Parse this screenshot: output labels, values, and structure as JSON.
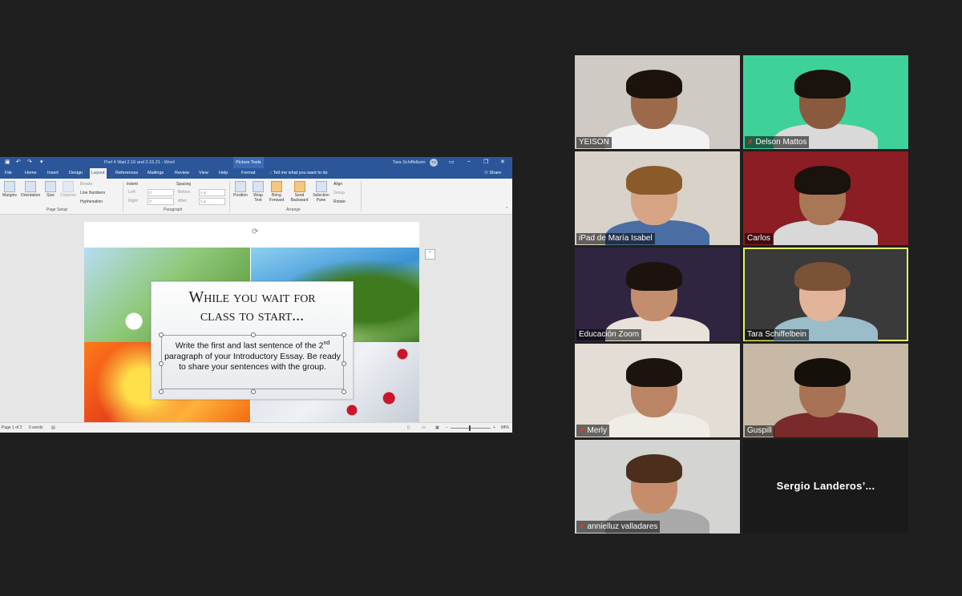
{
  "word": {
    "title": "Pref 4 Wait 2.16 and 2.15.21  -  Word",
    "picture_tools": "Picture Tools",
    "user": "Tara Schiffelbein",
    "user_initials": "TS",
    "tabs": [
      "File",
      "Home",
      "Insert",
      "Design",
      "Layout",
      "References",
      "Mailings",
      "Review",
      "View",
      "Help",
      "Format"
    ],
    "active_tab": "Layout",
    "tell_me": "Tell me what you want to do",
    "share": "Share",
    "ribbon": {
      "margins": "Margins",
      "orientation": "Orientation",
      "size": "Size",
      "columns": "Columns",
      "breaks": "Breaks",
      "line_numbers": "Line Numbers",
      "hyphenation": "Hyphenation",
      "indent": "Indent",
      "indent_left": "Left:",
      "indent_right": "Right:",
      "spacing": "Spacing",
      "spacing_before": "Before:",
      "spacing_after": "After:",
      "indent_left_value": "0\"",
      "indent_right_value": "0\"",
      "spacing_before_value": "0 pt",
      "spacing_after_value": "0 pt",
      "position": "Position",
      "wrap_text": "Wrap Text",
      "bring_forward": "Bring Forward",
      "send_backward": "Send Backward",
      "selection_pane": "Selection Pane",
      "align": "Align",
      "group": "Group",
      "rotate": "Rotate",
      "group_page_setup": "Page Setup",
      "group_paragraph": "Paragraph",
      "group_arrange": "Arrange"
    },
    "card_title_line1": "While you wait for",
    "card_title_line2": "class to start...",
    "card_body_a": "Write the first and last sentence of the 2",
    "card_body_sup": "nd",
    "card_body_b": "paragraph of your Introductory Essay. Be ready to share your sentences with the group.",
    "status_page": "Page 1 of 2",
    "status_words": "0 words",
    "zoom": "84%"
  },
  "participants": [
    {
      "name": "YEISON",
      "muted": false,
      "speaking": false,
      "bg": "#cfcac3",
      "shirt": "#f2f2f2",
      "hair": "#1b120c",
      "skin": "#9c6a4b"
    },
    {
      "name": "Delson Mattos",
      "muted": true,
      "speaking": false,
      "bg": "#3ed29a",
      "shirt": "#d9d9d9",
      "hair": "#1a120c",
      "skin": "#8a5a3e"
    },
    {
      "name": "iPad de María Isabel",
      "muted": false,
      "speaking": false,
      "bg": "#d8d2c9",
      "shirt": "#4a6ea3",
      "hair": "#8b5a2b",
      "skin": "#d6a385"
    },
    {
      "name": "Carlos",
      "muted": false,
      "speaking": false,
      "bg": "#8c1d24",
      "shirt": "#d8d8d8",
      "hair": "#1a120c",
      "skin": "#a97755"
    },
    {
      "name": "Educación Zoom",
      "muted": false,
      "speaking": false,
      "bg": "#2f2540",
      "shirt": "#e8e2da",
      "hair": "#1d130e",
      "skin": "#c38e6d"
    },
    {
      "name": "Tara Schiffelbein",
      "muted": false,
      "speaking": true,
      "bg": "#3a3a3a",
      "shirt": "#9bbcc9",
      "hair": "#7a5235",
      "skin": "#e2b49a"
    },
    {
      "name": "Merly",
      "muted": true,
      "speaking": false,
      "bg": "#e3ddd5",
      "shirt": "#f0ece6",
      "hair": "#1c130e",
      "skin": "#bb8565"
    },
    {
      "name": "Guspill",
      "muted": false,
      "speaking": false,
      "bg": "#c7b9a6",
      "shirt": "#7a2a2a",
      "hair": "#16100b",
      "skin": "#a77354"
    },
    {
      "name": "annielluz valladares",
      "muted": true,
      "speaking": false,
      "bg": "#d4d4d2",
      "shirt": "#a9a9a9",
      "hair": "#4b2e1c",
      "skin": "#c58d6c"
    },
    {
      "name": "Sergio  Landeros’...",
      "muted": false,
      "speaking": false,
      "name_only": true
    }
  ],
  "mic_muted_icon": "mic-muted-icon"
}
